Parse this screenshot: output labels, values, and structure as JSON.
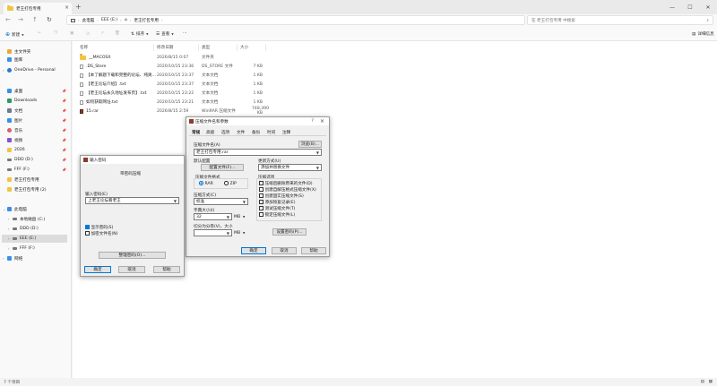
{
  "window": {
    "tab_title": "老王打包专用",
    "tab_close": "×",
    "tab_new": "+",
    "controls": [
      "—",
      "☐",
      "✕"
    ]
  },
  "address": {
    "crumbs": [
      "此电脑",
      "EEE (E:)",
      "⌂",
      "老王打包专用"
    ],
    "search_placeholder": "在 老王打包专用 中搜索"
  },
  "toolbar": {
    "new_label": "新建",
    "sort_label": "排序",
    "view_label": "查看",
    "more_label": "···",
    "details_label": "详细信息"
  },
  "sidebar": {
    "items": [
      {
        "label": "主文件夹",
        "color": "#e8a93a"
      },
      {
        "label": "图库",
        "color": "#3a8fe8"
      },
      {
        "label": "OneDrive - Personal",
        "color": "#2b78d1"
      },
      {
        "label": "桌面",
        "color": "#3a8fe8"
      },
      {
        "label": "Downloads",
        "color": "#2b9a5e"
      },
      {
        "label": "文档",
        "color": "#6d7a8a"
      },
      {
        "label": "图片",
        "color": "#3a8fe8"
      },
      {
        "label": "音乐",
        "color": "#e25a6b"
      },
      {
        "label": "视频",
        "color": "#8a4ed1"
      },
      {
        "label": "2026",
        "color": "#f2c441"
      },
      {
        "label": "DDD (D:)",
        "color": "#777777"
      },
      {
        "label": "FFF (F:)",
        "color": "#777777"
      },
      {
        "label": "老王打包专用",
        "color": "#f2c441"
      },
      {
        "label": "老王打包专用 (2)",
        "color": "#f2c441"
      },
      {
        "label": "此电脑",
        "color": "#3a8fe8"
      },
      {
        "label": "本地磁盘 (C:)",
        "color": "#777777"
      },
      {
        "label": "DDD (D:)",
        "color": "#777777"
      },
      {
        "label": "EEE (E:)",
        "color": "#777777"
      },
      {
        "label": "FFF (F:)",
        "color": "#777777"
      },
      {
        "label": "网络",
        "color": "#3a8fe8"
      }
    ]
  },
  "files": {
    "headers": [
      "名称",
      "修改日期",
      "类型",
      "大小"
    ],
    "rows": [
      {
        "name": "__MACOSX",
        "date": "2026/8/15 0:07",
        "type": "文件夹",
        "size": "",
        "kind": "folder"
      },
      {
        "name": ".DS_Store",
        "date": "2020/10/15 23:36",
        "type": "DS_STORE 文件",
        "size": "7 KB",
        "kind": "file"
      },
      {
        "name": "【本了解题下载和完整的论坛、纯爽集】.txt",
        "date": "2020/10/15 23:37",
        "type": "文本文档",
        "size": "1 KB",
        "kind": "file"
      },
      {
        "name": "【老王论坛介绍】.txt",
        "date": "2020/10/15 23:37",
        "type": "文本文档",
        "size": "1 KB",
        "kind": "file"
      },
      {
        "name": "【老王论坛永久地址发布页】.txt",
        "date": "2020/10/15 23:22",
        "type": "文本文档",
        "size": "1 KB",
        "kind": "file"
      },
      {
        "name": "如何获取网址.txt",
        "date": "2020/10/15 23:21",
        "type": "文本文档",
        "size": "1 KB",
        "kind": "file"
      },
      {
        "name": "15.rar",
        "date": "2026/8/15 2:59",
        "type": "WinRAR 压缩文件",
        "size": "748,390 KB",
        "kind": "rar"
      }
    ]
  },
  "status": {
    "text": "7 个项目"
  },
  "pwd_dialog": {
    "title": "输入密码",
    "heading": "带密码压缩",
    "label": "输入密码(E)",
    "value": "上老王论坛看老王",
    "check1": "显示密码(S)",
    "check2": "加密文件名(N)",
    "manage": "整理密码(O)...",
    "ok": "确定",
    "cancel": "取消",
    "help": "帮助"
  },
  "archive_dialog": {
    "title": "压缩文件名和参数",
    "help_q": "?",
    "close": "×",
    "tabs": [
      "常规",
      "高级",
      "选项",
      "文件",
      "备份",
      "时间",
      "注释"
    ],
    "name_label": "压缩文件名(A)",
    "browse": "浏览(B)...",
    "name_value": "老王打包专用.rar",
    "profile_label": "默认配置",
    "profile_btn": "配置文件(F)...",
    "update_label": "更新方式(U)",
    "update_value": "添加并替换文件",
    "format_label": "压缩文件格式",
    "format_rar": "RAR",
    "format_zip": "ZIP",
    "method_label": "压缩方式(C)",
    "method_value": "标准",
    "dict_label": "字典大小(I)",
    "dict_value": "32",
    "dict_unit": "MB",
    "split_label": "切分为分卷(V)，大小",
    "split_unit": "MB",
    "options_label": "压缩选项",
    "options": [
      {
        "label": "压缩后删除原来的文件(D)",
        "checked": false
      },
      {
        "label": "创建自解压格式压缩文件(X)",
        "checked": false
      },
      {
        "label": "创建固实压缩文件(S)",
        "checked": false
      },
      {
        "label": "添加恢复记录(E)",
        "checked": false
      },
      {
        "label": "测试压缩文件(T)",
        "checked": false
      },
      {
        "label": "锁定压缩文件(L)",
        "checked": false
      }
    ],
    "setpwd": "设置密码(P)...",
    "ok": "确定",
    "cancel": "取消",
    "help": "帮助"
  }
}
